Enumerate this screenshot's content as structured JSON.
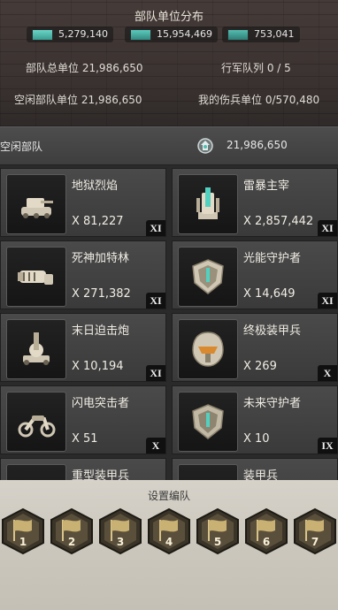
{
  "header": {
    "title": "部队单位分布",
    "pills": [
      {
        "value": "5,279,140",
        "color": "#4fbfb0"
      },
      {
        "value": "15,954,469",
        "color": "#3fa8a0"
      },
      {
        "value": "753,041",
        "color": "#33908a"
      }
    ],
    "total_label": "部队总单位",
    "total_value": "21,986,650",
    "march_label": "行军队列",
    "march_value": "0 / 5",
    "idle_label": "空闲部队单位",
    "idle_value": "21,986,650",
    "wounded_label": "我的伤兵单位",
    "wounded_value": "0/570,480"
  },
  "idle_row": {
    "label": "空闲部队",
    "total": "21,986,650"
  },
  "units": [
    {
      "name": "地狱烈焰",
      "count": "X 81,227",
      "tier": "XI",
      "icon": "tank-icon"
    },
    {
      "name": "雷暴主宰",
      "count": "X 2,857,442",
      "tier": "XI",
      "icon": "tesla-tower-icon"
    },
    {
      "name": "死神加特林",
      "count": "X 271,382",
      "tier": "XI",
      "icon": "gatling-icon"
    },
    {
      "name": "光能守护者",
      "count": "X 14,649",
      "tier": "XI",
      "icon": "shield-guardian-icon"
    },
    {
      "name": "末日迫击炮",
      "count": "X 10,194",
      "tier": "XI",
      "icon": "mortar-icon"
    },
    {
      "name": "终极装甲兵",
      "count": "X 269",
      "tier": "X",
      "icon": "armor-helmet-icon"
    },
    {
      "name": "闪电突击者",
      "count": "X 51",
      "tier": "X",
      "icon": "motorcycle-icon"
    },
    {
      "name": "未来守护者",
      "count": "X 10",
      "tier": "IX",
      "icon": "shield-guardian-icon"
    },
    {
      "name": "重型装甲兵",
      "count": "",
      "tier": "",
      "icon": "armor-helmet-icon"
    },
    {
      "name": "装甲兵",
      "count": "",
      "tier": "",
      "icon": "armor-helmet-icon"
    }
  ],
  "footer": {
    "title": "设置编队",
    "presets": [
      "1",
      "2",
      "3",
      "4",
      "5",
      "6",
      "7"
    ]
  }
}
